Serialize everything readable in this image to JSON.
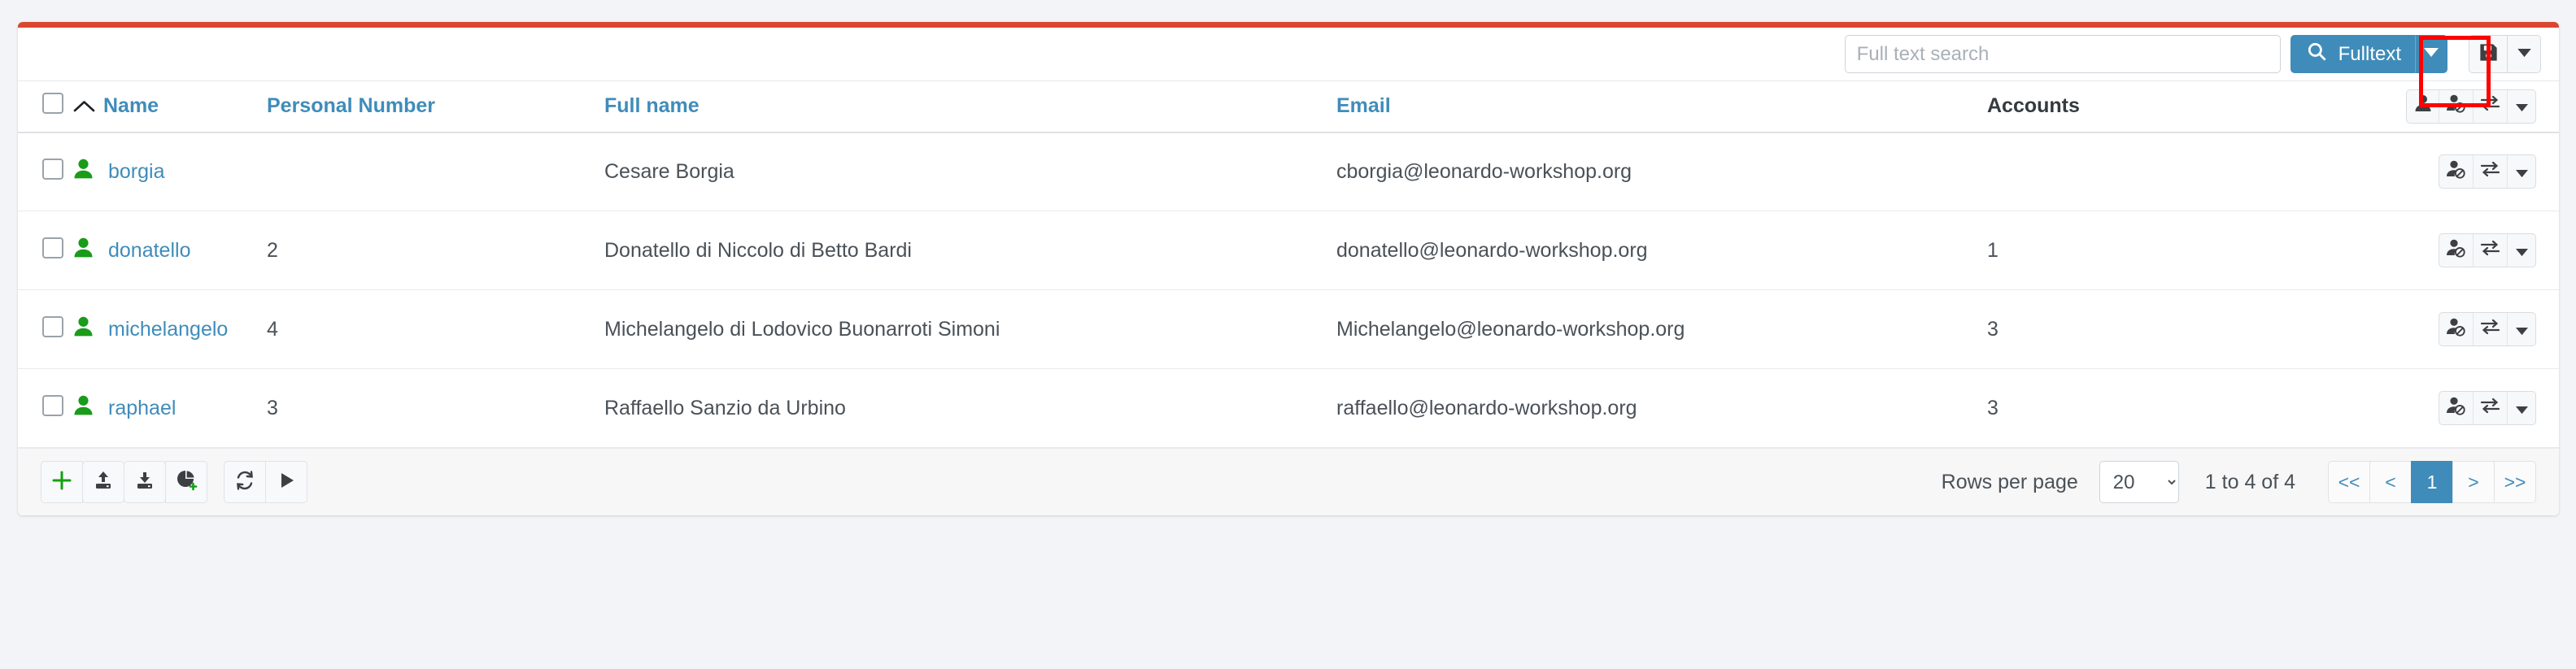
{
  "theme": {
    "accent_bar_color": "#d9472f",
    "link_color": "#3f8cba",
    "primary_button_color": "#3f8cba",
    "highlight_color": "#ff0000",
    "status_icon_color": "#1a9b1a",
    "page_background": "#f2f4f8"
  },
  "toolbar": {
    "search_placeholder": "Full text search",
    "search_value": "",
    "fulltext_label": "Fulltext",
    "search_icon": "search-icon",
    "fulltext_caret_icon": "caret-down-icon",
    "save_icon": "save-floppy-icon",
    "save_caret_icon": "caret-down-icon"
  },
  "table": {
    "columns": [
      {
        "key": "check",
        "label": "",
        "sortable": false
      },
      {
        "key": "name",
        "label": "Name",
        "sortable": true,
        "sorted": "asc",
        "sort_icon": "chevron-up-icon"
      },
      {
        "key": "personal",
        "label": "Personal Number",
        "sortable": true
      },
      {
        "key": "fullname",
        "label": "Full name",
        "sortable": true
      },
      {
        "key": "email",
        "label": "Email",
        "sortable": true
      },
      {
        "key": "accounts",
        "label": "Accounts",
        "sortable": false
      },
      {
        "key": "actions",
        "label": "",
        "sortable": false
      }
    ],
    "header_actions": [
      {
        "icon": "user-icon",
        "label": ""
      },
      {
        "icon": "user-disable-icon",
        "label": ""
      },
      {
        "icon": "exchange-icon",
        "label": ""
      },
      {
        "icon": "caret-down-icon",
        "label": ""
      }
    ],
    "row_actions": [
      {
        "icon": "user-disable-icon",
        "label": ""
      },
      {
        "icon": "exchange-icon",
        "label": ""
      },
      {
        "icon": "caret-down-icon",
        "label": ""
      }
    ],
    "rows": [
      {
        "name": "borgia",
        "personal_number": "",
        "full_name": "Cesare Borgia",
        "email": "cborgia@leonardo-workshop.org",
        "accounts": "",
        "status_icon": "user-enabled-icon",
        "checked": false
      },
      {
        "name": "donatello",
        "personal_number": "2",
        "full_name": "Donatello di Niccolo di Betto Bardi",
        "email": "donatello@leonardo-workshop.org",
        "accounts": "1",
        "status_icon": "user-enabled-icon",
        "checked": false
      },
      {
        "name": "michelangelo",
        "personal_number": "4",
        "full_name": "Michelangelo di Lodovico Buonarroti Simoni",
        "email": "Michelangelo@leonardo-workshop.org",
        "accounts": "3",
        "status_icon": "user-enabled-icon",
        "checked": false
      },
      {
        "name": "raphael",
        "personal_number": "3",
        "full_name": "Raffaello Sanzio da Urbino",
        "email": "raffaello@leonardo-workshop.org",
        "accounts": "3",
        "status_icon": "user-enabled-icon",
        "checked": false
      }
    ]
  },
  "footer": {
    "actions_primary": [
      {
        "icon": "plus-icon"
      },
      {
        "icon": "upload-icon"
      },
      {
        "icon": "download-icon"
      },
      {
        "icon": "add-report-icon"
      }
    ],
    "actions_secondary": [
      {
        "icon": "refresh-icon"
      },
      {
        "icon": "run-icon"
      }
    ],
    "rows_per_page_label": "Rows per page",
    "rows_per_page_value": "20",
    "rows_per_page_options": [
      "20"
    ],
    "range_label": "1 to 4 of 4",
    "pagination": [
      {
        "label": "<<",
        "name": "first-page",
        "active": false
      },
      {
        "label": "<",
        "name": "previous-page",
        "active": false
      },
      {
        "label": "1",
        "name": "page-1",
        "active": true
      },
      {
        "label": ">",
        "name": "next-page",
        "active": false
      },
      {
        "label": ">>",
        "name": "last-page",
        "active": false
      }
    ]
  }
}
